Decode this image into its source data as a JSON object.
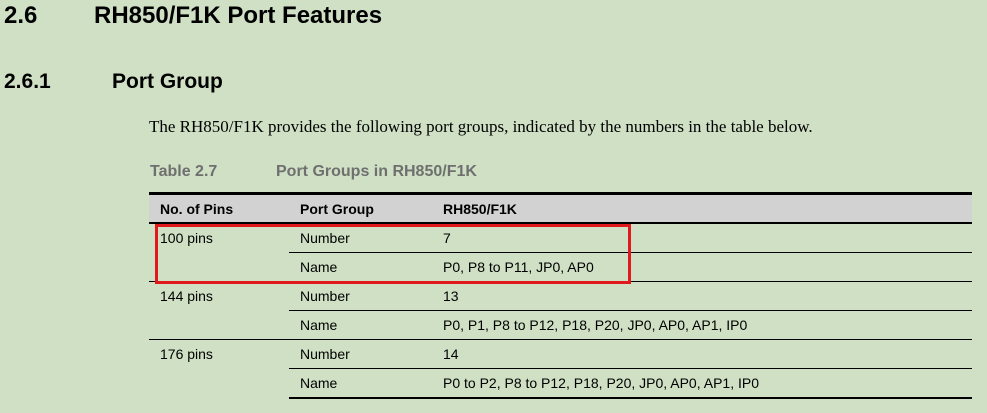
{
  "heading": {
    "number": "2.6",
    "title": "RH850/F1K Port Features"
  },
  "subheading": {
    "number": "2.6.1",
    "title": "Port Group"
  },
  "intro_text": "The RH850/F1K provides the following port groups, indicated by the numbers in the table below.",
  "table": {
    "caption_number": "Table 2.7",
    "caption_title": "Port Groups in RH850/F1K",
    "headers": [
      "No. of Pins",
      "Port Group",
      "RH850/F1K"
    ],
    "groups": [
      {
        "pins": "100 pins",
        "rows": [
          {
            "label": "Number",
            "value": "7"
          },
          {
            "label": "Name",
            "value": "P0, P8 to P11, JP0, AP0"
          }
        ]
      },
      {
        "pins": "144 pins",
        "rows": [
          {
            "label": "Number",
            "value": "13"
          },
          {
            "label": "Name",
            "value": "P0, P1, P8 to P12, P18, P20, JP0, AP0, AP1, IP0"
          }
        ]
      },
      {
        "pins": "176 pins",
        "rows": [
          {
            "label": "Number",
            "value": "14"
          },
          {
            "label": "Name",
            "value": "P0 to P2, P8 to P12, P18, P20, JP0, AP0, AP1, IP0"
          }
        ]
      }
    ]
  },
  "highlight_color": "#e0191c"
}
